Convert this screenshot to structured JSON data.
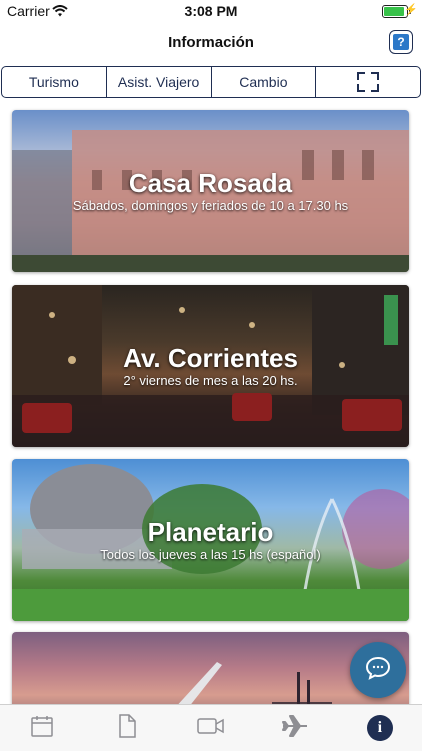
{
  "status_bar": {
    "carrier": "Carrier",
    "time": "3:08 PM"
  },
  "nav": {
    "title": "Información",
    "help_label": "?"
  },
  "segments": [
    "Turismo",
    "Asist. Viajero",
    "Cambio"
  ],
  "cards": [
    {
      "title": "Casa Rosada",
      "subtitle": "Sábados, domingos y feriados de 10 a 17.30 hs"
    },
    {
      "title": "Av. Corrientes",
      "subtitle": "2° viernes de mes a las 20 hs."
    },
    {
      "title": "Planetario",
      "subtitle": "Todos los jueves a las 15 hs (español)"
    },
    {
      "title": "",
      "subtitle": ""
    }
  ],
  "tab_bar": {
    "items": [
      "calendar-icon",
      "document-icon",
      "video-icon",
      "airplane-icon",
      "info-icon"
    ],
    "info_label": "i",
    "accent": "#1f2e52"
  },
  "colors": {
    "accent": "#1f2e52",
    "help_blue": "#2c78c8",
    "chat_button": "#2e6f9c",
    "battery": "#38c24a"
  }
}
